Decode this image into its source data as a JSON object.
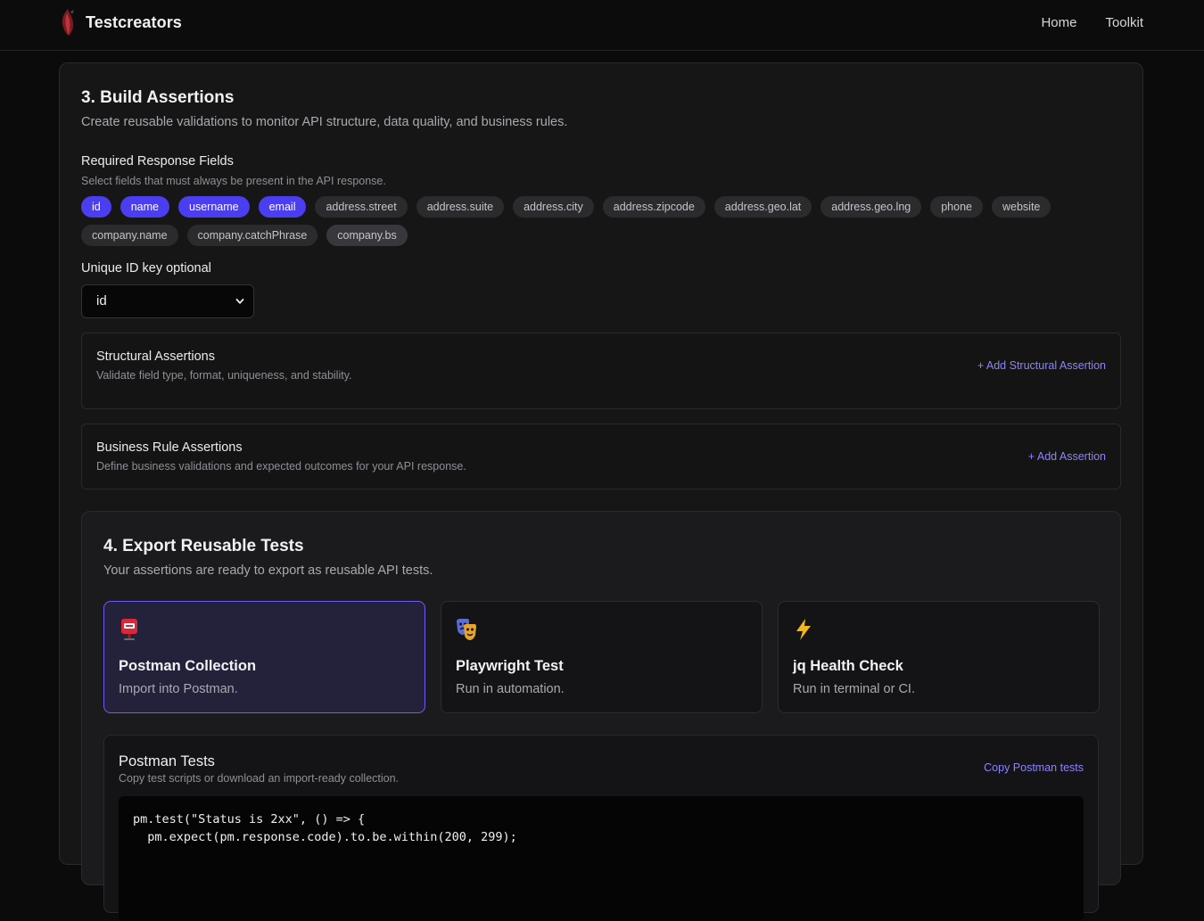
{
  "header": {
    "brand": "Testcreators",
    "nav": [
      "Home",
      "Toolkit"
    ]
  },
  "assertions": {
    "title": "3. Build Assertions",
    "subtitle": "Create reusable validations to monitor API structure, data quality, and business rules.",
    "required_fields": {
      "label": "Required Response Fields",
      "hint": "Select fields that must always be present in the API response.",
      "chips": [
        {
          "label": "id",
          "selected": true
        },
        {
          "label": "name",
          "selected": true
        },
        {
          "label": "username",
          "selected": true
        },
        {
          "label": "email",
          "selected": true
        },
        {
          "label": "address.street",
          "selected": false
        },
        {
          "label": "address.suite",
          "selected": false
        },
        {
          "label": "address.city",
          "selected": false
        },
        {
          "label": "address.zipcode",
          "selected": false
        },
        {
          "label": "address.geo.lat",
          "selected": false
        },
        {
          "label": "address.geo.lng",
          "selected": false
        },
        {
          "label": "phone",
          "selected": false
        },
        {
          "label": "website",
          "selected": false
        },
        {
          "label": "company.name",
          "selected": false
        },
        {
          "label": "company.catchPhrase",
          "selected": false
        },
        {
          "label": "company.bs",
          "selected": false
        }
      ]
    },
    "unique_id": {
      "label": "Unique ID key optional",
      "value": "id"
    },
    "structural": {
      "title": "Structural Assertions",
      "description": "Validate field type, format, uniqueness, and stability.",
      "action": "+ Add Structural Assertion"
    },
    "business": {
      "title": "Business Rule Assertions",
      "description": "Define business validations and expected outcomes for your API response.",
      "action": "+ Add Assertion"
    }
  },
  "export": {
    "title": "4. Export Reusable Tests",
    "subtitle": "Your assertions are ready to export as reusable API tests.",
    "cards": [
      {
        "icon": "postbox-icon",
        "title": "Postman Collection",
        "description": "Import into Postman.",
        "selected": true
      },
      {
        "icon": "theater-masks-icon",
        "title": "Playwright Test",
        "description": "Run in automation.",
        "selected": false
      },
      {
        "icon": "lightning-icon",
        "title": "jq Health Check",
        "description": "Run in terminal or CI.",
        "selected": false
      }
    ],
    "tests": {
      "title": "Postman Tests",
      "description": "Copy test scripts or download an import-ready collection.",
      "action": "Copy Postman tests",
      "code": "pm.test(\"Status is 2xx\", () => {\n  pm.expect(pm.response.code).to.be.within(200, 299);"
    }
  },
  "colors": {
    "accent": "#4b3df0",
    "link": "#8b84ff",
    "background": "#0b0b0c"
  }
}
